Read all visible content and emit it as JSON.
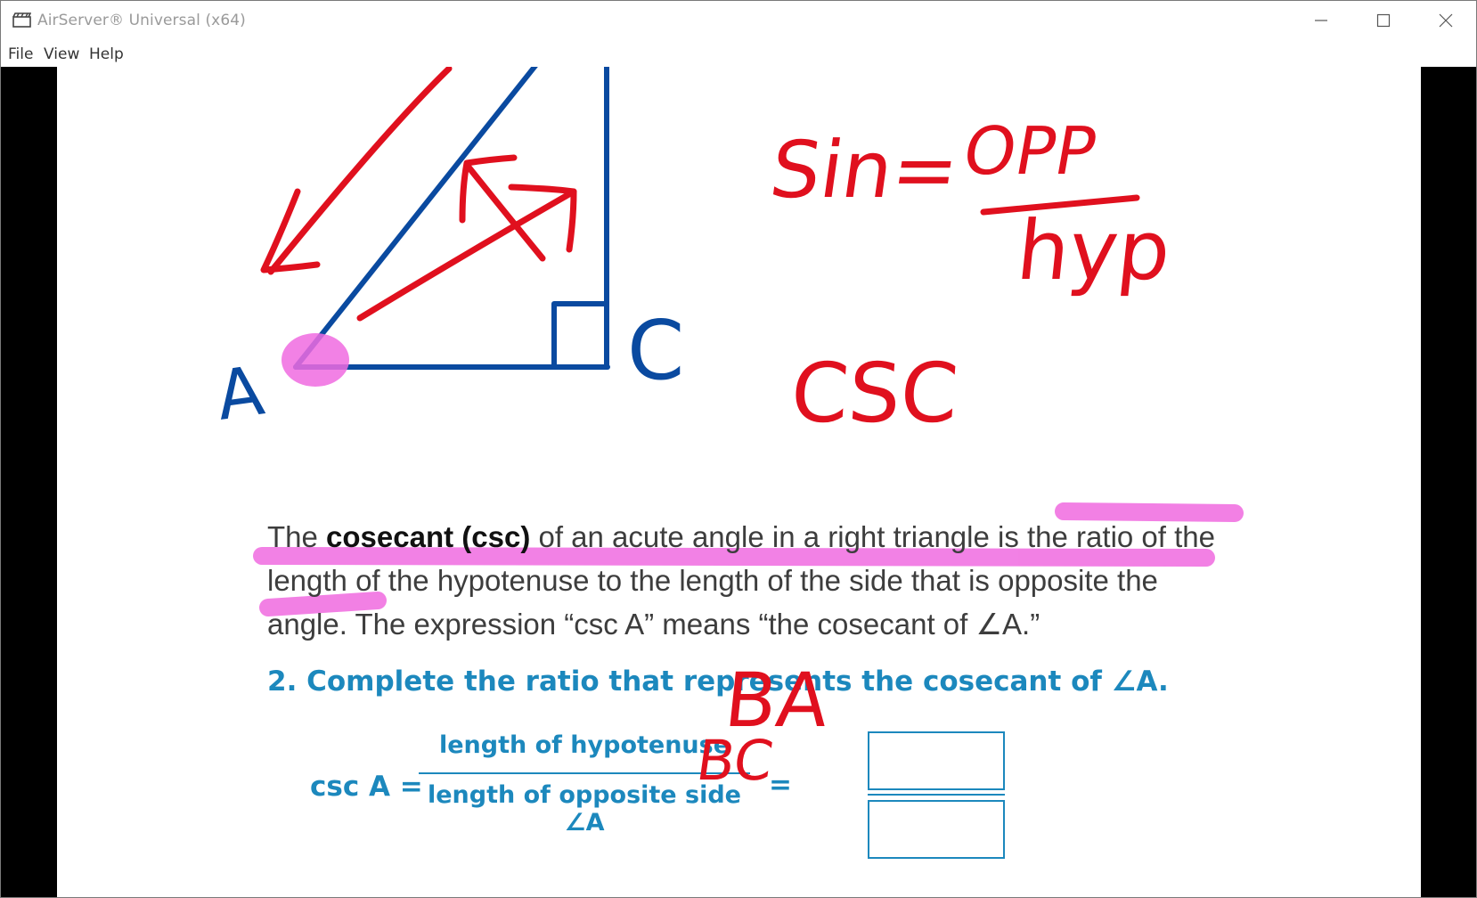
{
  "window": {
    "title": "AirServer® Universal (x64)",
    "icon": "clapperboard-icon"
  },
  "menu": {
    "items": [
      "File",
      "View",
      "Help"
    ]
  },
  "slide": {
    "paragraph": {
      "lead": "The ",
      "term": "cosecant (csc)",
      "rest": " of an acute angle in a right triangle is the ratio of the length of the hypotenuse to the length of the side that is opposite the angle. The expression “csc A” means “the cosecant of ∠A.”"
    },
    "question": "2.  Complete the ratio that represents the cosecant of ∠A.",
    "formula": {
      "lhs": "csc A =",
      "numerator": "length of hypotenuse",
      "denominator": "length of opposite side ∠A",
      "equals": "="
    },
    "annotations": {
      "vertex_a": "A",
      "vertex_c": "C",
      "sin_lhs": "Sin=",
      "sin_num": "OPP",
      "sin_den": "hyp",
      "csc": "CSC",
      "answer_top": "BA",
      "answer_bottom": "BC"
    },
    "colors": {
      "ink_red": "#e0101e",
      "ink_blue": "#0a4aa0",
      "highlighter": "#f06be0",
      "accent_blue": "#1c88bd"
    }
  }
}
